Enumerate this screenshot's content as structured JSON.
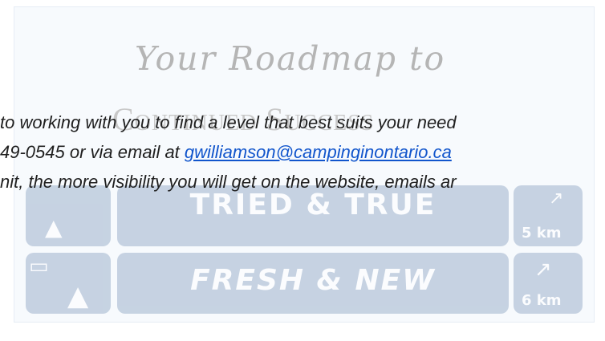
{
  "graphic": {
    "script_heading": "Your Roadmap to",
    "caps_heading": "Continued Success",
    "tiles": [
      {
        "label": "TRIED & TRUE",
        "distance": "5 km"
      },
      {
        "label": "FRESH & NEW",
        "distance": "6 km"
      }
    ]
  },
  "text": {
    "line1": "to working with you to find a level that best suits your need",
    "line2_prefix": "49-0545 or via email at ",
    "email": "gwilliamson@campinginontario.ca",
    "line3": "nit, the more visibility you will get on the website, emails ar"
  },
  "colors": {
    "tile": "#9fb3cc",
    "link": "#1155cc"
  }
}
